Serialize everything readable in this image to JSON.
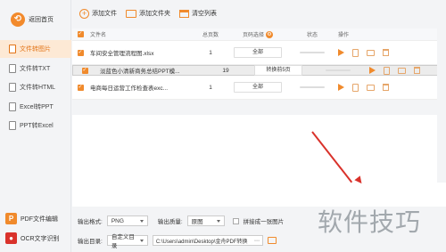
{
  "sidebar": {
    "back_label": "返回首页",
    "items": [
      {
        "label": "文件转图片",
        "active": true
      },
      {
        "label": "文件转TXT",
        "active": false
      },
      {
        "label": "文件转HTML",
        "active": false
      },
      {
        "label": "Excel转PPT",
        "active": false
      },
      {
        "label": "PPT转Excel",
        "active": false
      }
    ],
    "pdf_edit_label": "PDF文件编辑",
    "ocr_label": "OCR文字识别"
  },
  "toolbar": {
    "add_file": "添加文件",
    "add_folder": "添加文件夹",
    "clear_list": "清空列表"
  },
  "table": {
    "headers": {
      "name": "文件名",
      "pages": "总页数",
      "range": "页码选择",
      "status": "状态",
      "ops": "操作"
    },
    "rows": [
      {
        "name": "车间安全管理流程图.xlsx",
        "pages": "1",
        "range": "全部",
        "checked": true,
        "selected": false
      },
      {
        "name": "淡蓝色小清新商务总结PPT模...",
        "pages": "19",
        "range": "转换前5页",
        "checked": true,
        "selected": true
      },
      {
        "name": "电商每日运营工作检查表exc...",
        "pages": "1",
        "range": "全部",
        "checked": true,
        "selected": false
      }
    ]
  },
  "settings": {
    "format_label": "输出格式:",
    "format_value": "PNG",
    "quality_label": "输出质量:",
    "quality_value": "原图",
    "merge_label": "拼接成一张图片",
    "dir_label": "输出目录:",
    "dir_value": "自定义目录",
    "path_value": "C:\\Users\\admin\\Desktop\\金舟PDF转换"
  },
  "watermark": "软件技巧",
  "colors": {
    "accent": "#f08a2c",
    "arrow": "#d9322b"
  }
}
